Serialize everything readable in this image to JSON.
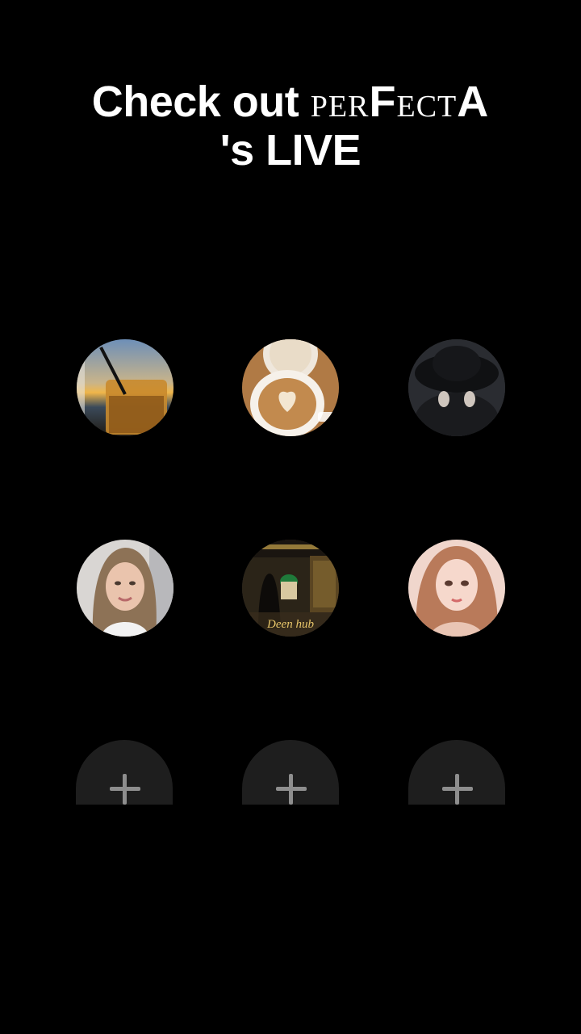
{
  "title": {
    "prefix": "Check out",
    "name_parts": [
      "per",
      "F",
      "ect",
      "A"
    ],
    "suffix": "'s LIVE"
  },
  "avatars": [
    {
      "icon": "drink-sunset-avatar"
    },
    {
      "icon": "latte-art-avatar"
    },
    {
      "icon": "hat-person-avatar"
    },
    {
      "icon": "girl-portrait-avatar"
    },
    {
      "icon": "deen-hub-avatar",
      "caption": "Deen hub"
    },
    {
      "icon": "anime-girl-avatar"
    }
  ],
  "add_slots": [
    {
      "icon": "plus-icon"
    },
    {
      "icon": "plus-icon"
    },
    {
      "icon": "plus-icon"
    }
  ],
  "colors": {
    "background": "#000000",
    "title": "#ffffff",
    "add_slot": "#1e1e1e",
    "plus": "#8e8e8e"
  }
}
